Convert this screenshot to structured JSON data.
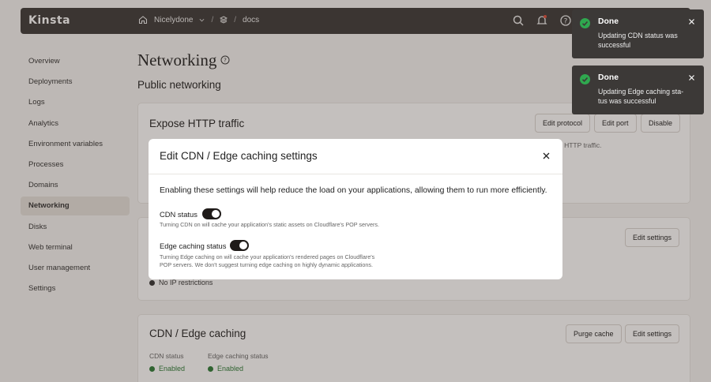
{
  "header": {
    "logo": "Kinsta",
    "breadcrumb": {
      "company": "Nicelydone",
      "separator": "/",
      "app": "docs"
    }
  },
  "sidebar": {
    "items": [
      {
        "label": "Overview"
      },
      {
        "label": "Deployments"
      },
      {
        "label": "Logs"
      },
      {
        "label": "Analytics"
      },
      {
        "label": "Environment variables"
      },
      {
        "label": "Processes"
      },
      {
        "label": "Domains"
      },
      {
        "label": "Networking",
        "active": true
      },
      {
        "label": "Disks"
      },
      {
        "label": "Web terminal"
      },
      {
        "label": "User management"
      },
      {
        "label": "Settings"
      }
    ]
  },
  "main": {
    "page_title": "Networking",
    "section_title": "Public networking",
    "http_card": {
      "title": "Expose HTTP traffic",
      "buttons": {
        "edit_protocol": "Edit protocol",
        "edit_port": "Edit port",
        "disable": "Disable"
      },
      "partial_text": "g HTTP traffic."
    },
    "ip_card": {
      "edit_settings": "Edit settings",
      "ip_restrictions": "No IP restrictions"
    },
    "cdn_card": {
      "title": "CDN / Edge caching",
      "buttons": {
        "purge_cache": "Purge cache",
        "edit_settings": "Edit settings"
      },
      "cdn_status_label": "CDN status",
      "cdn_status_value": "Enabled",
      "edge_status_label": "Edge caching status",
      "edge_status_value": "Enabled"
    }
  },
  "modal": {
    "title": "Edit CDN / Edge caching settings",
    "intro": "Enabling these settings will help reduce the load on your applications, allowing them to run more efficiently.",
    "cdn": {
      "label": "CDN status",
      "enabled": true,
      "desc": "Turning CDN on will cache your application's static assets on Cloudflare's POP servers."
    },
    "edge": {
      "label": "Edge caching status",
      "enabled": true,
      "desc_line1": "Turning Edge caching on will cache your application's rendered pages on Cloudflare's",
      "desc_line2": "POP servers. We don't suggest turning edge caching on highly dynamic applications."
    }
  },
  "toasts": [
    {
      "title": "Done",
      "message_line1": "Updating CDN status was",
      "message_line2": "successful"
    },
    {
      "title": "Done",
      "message_line1": "Updating Edge caching sta-",
      "message_line2": "tus was successful"
    }
  ],
  "colors": {
    "header_bg": "#3c3937",
    "success": "#2fa84f",
    "enabled_text": "#2b7a35",
    "toggle_on": "#1f1b19"
  }
}
